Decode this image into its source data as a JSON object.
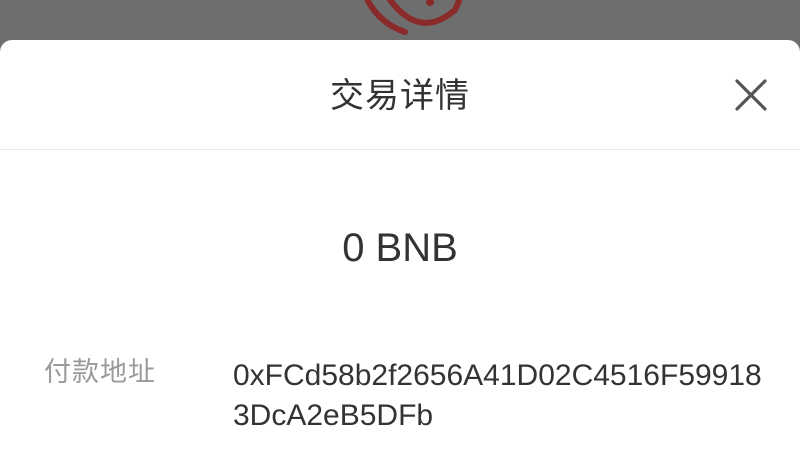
{
  "sheet": {
    "title": "交易详情",
    "close_icon": "close-icon"
  },
  "transaction": {
    "amount": "0 BNB",
    "payer_label": "付款地址",
    "payer_address": "0xFCd58b2f2656A41D02C4516F599183DcA2eB5DFb"
  },
  "colors": {
    "backdrop": "#6e6e6e",
    "sheet_background": "#ffffff",
    "text_primary": "#333333",
    "text_secondary": "#9a9a9a",
    "divider": "#e6e6e6",
    "background_icon": "#8a2a2a"
  }
}
